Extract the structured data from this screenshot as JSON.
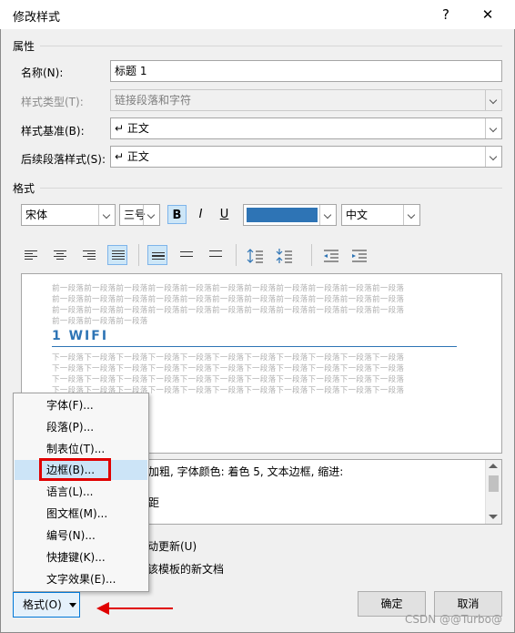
{
  "window": {
    "title": "修改样式",
    "help": "?",
    "close": "✕"
  },
  "properties": {
    "section_title": "属性",
    "name_label": "名称(N):",
    "name_value": "标题 1",
    "type_label": "样式类型(T):",
    "type_value": "链接段落和字符",
    "based_label": "样式基准(B):",
    "based_value": "↵ 正文",
    "next_label": "后续段落样式(S):",
    "next_value": "↵ 正文"
  },
  "format": {
    "section_title": "格式",
    "font": "宋体",
    "size": "三号",
    "bold": "B",
    "italic": "I",
    "underline": "U",
    "color": "#2e74b5",
    "language": "中文"
  },
  "preview": {
    "prev_lines": [
      "前一段落前一段落前一段落前一段落前一段落前一段落前一段落前一段落前一段落前一段落前一段落",
      "前一段落前一段落前一段落前一段落前一段落前一段落前一段落前一段落前一段落前一段落前一段落",
      "前一段落前一段落前一段落前一段落前一段落前一段落前一段落前一段落前一段落前一段落前一段落",
      "前一段落前一段落前一段落"
    ],
    "heading": "1  WIFI",
    "next_lines": [
      "下一段落下一段落下一段落下一段落下一段落下一段落下一段落下一段落下一段落下一段落下一段落",
      "下一段落下一段落下一段落下一段落下一段落下一段落下一段落下一段落下一段落下一段落下一段落",
      "下一段落下一段落下一段落下一段落下一段落下一段落下一段落下一段落下一段落下一段落下一段落",
      "下一段落下一段落下一段落下一段落下一段落下一段落下一段落下一段落下一段落下一段落下一段落"
    ]
  },
  "description": {
    "line1": "加粗, 字体颜色: 着色 5, 文本边框, 缩进:",
    "line2": "距"
  },
  "options": {
    "auto_update": "动更新(U)",
    "new_docs": "该模板的新文档"
  },
  "menu": {
    "items": [
      "字体(F)...",
      "段落(P)...",
      "制表位(T)...",
      "边框(B)...",
      "语言(L)...",
      "图文框(M)...",
      "编号(N)...",
      "快捷键(K)...",
      "文字效果(E)..."
    ],
    "highlighted_index": 3
  },
  "buttons": {
    "format": "格式(O)",
    "ok": "确定",
    "cancel": "取消"
  },
  "watermark": "CSDN @@Turbo@",
  "colors": {
    "annotation": "#e00000",
    "accent": "#0078d7"
  }
}
